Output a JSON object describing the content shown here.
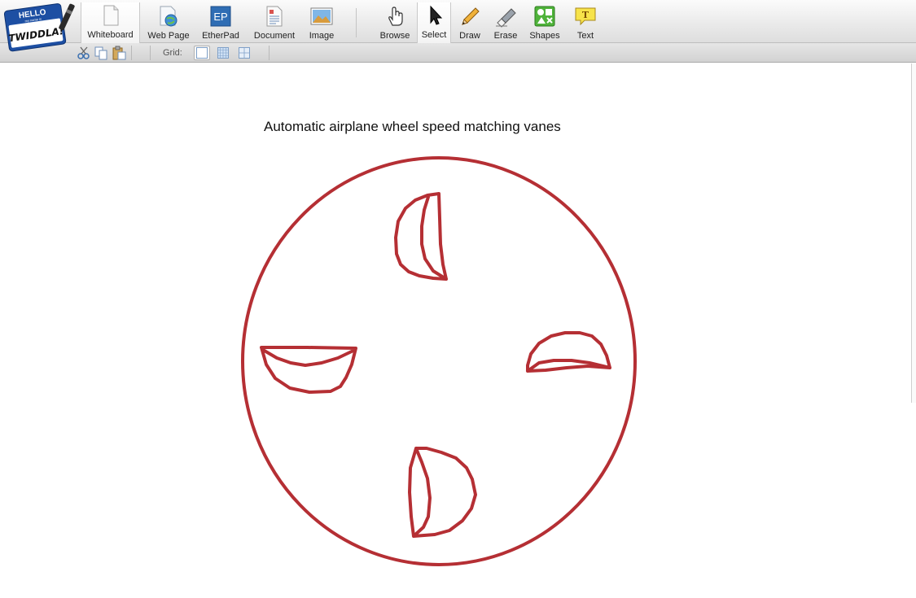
{
  "app": {
    "logo_top": "HELLO",
    "logo_mid": "my name is",
    "logo_name": "TWIDDLA!"
  },
  "toolbar": {
    "items": [
      {
        "label": "Whiteboard",
        "icon": "whiteboard-icon",
        "active": true
      },
      {
        "label": "Web Page",
        "icon": "web-page-icon"
      },
      {
        "label": "EtherPad",
        "icon": "etherpad-icon",
        "icon_text": "EP"
      },
      {
        "label": "Document",
        "icon": "document-icon"
      },
      {
        "label": "Image",
        "icon": "image-icon"
      },
      {
        "label": "Browse",
        "icon": "hand-icon"
      },
      {
        "label": "Select",
        "icon": "arrow-cursor-icon",
        "active": true
      },
      {
        "label": "Draw",
        "icon": "pencil-icon"
      },
      {
        "label": "Erase",
        "icon": "eraser-icon"
      },
      {
        "label": "Shapes",
        "icon": "shapes-icon"
      },
      {
        "label": "Text",
        "icon": "text-bubble-icon",
        "icon_text": "T"
      }
    ]
  },
  "subbar": {
    "edit_icons": [
      "cut-icon",
      "copy-icon",
      "paste-icon"
    ],
    "grid_label": "Grid:",
    "grid_options": [
      "grid-none-icon",
      "grid-fine-icon",
      "grid-large-icon"
    ],
    "grid_selected": 0
  },
  "whiteboard": {
    "title": "Automatic airplane wheel speed matching vanes",
    "stroke_color": "#b52f34",
    "shapes": [
      "wheel-circle",
      "vane-top",
      "vane-left",
      "vane-right",
      "vane-bottom"
    ]
  }
}
